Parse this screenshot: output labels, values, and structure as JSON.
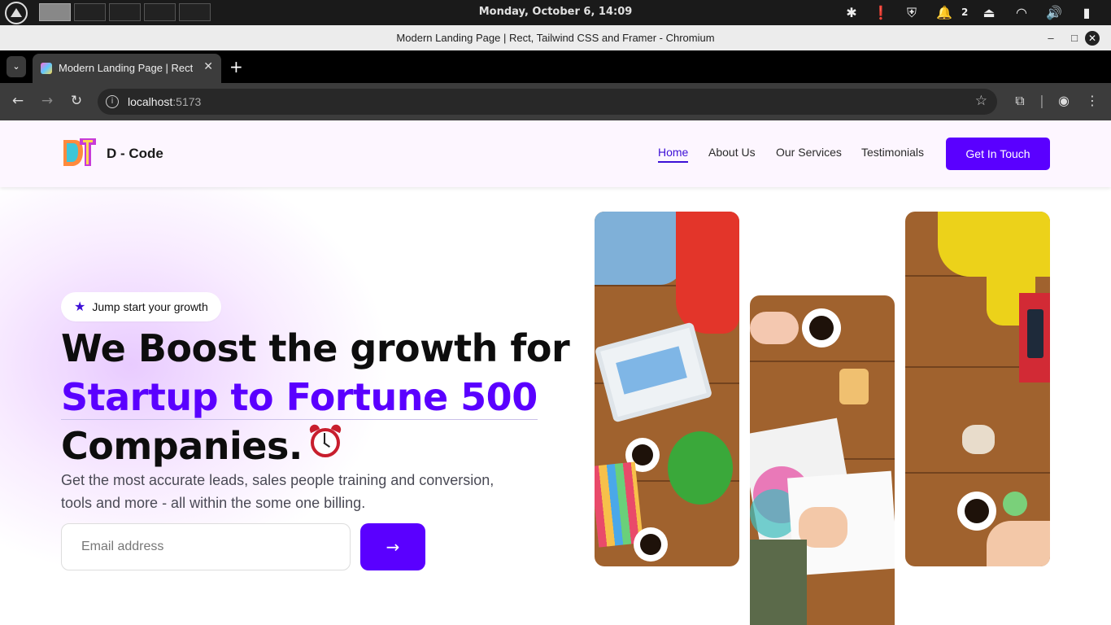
{
  "os": {
    "clock": "Monday, October   6, 14:09",
    "notifications_count": "2"
  },
  "window": {
    "title": "Modern Landing Page | Rect, Tailwind CSS and Framer - Chromium",
    "minimize": "–",
    "maximize": "□",
    "close": "✕"
  },
  "browser": {
    "tab_label": "Modern Landing Page | Rect",
    "tab_close": "✕",
    "new_tab": "+",
    "url_host": "localhost",
    "url_port": ":5173"
  },
  "site": {
    "brand": "D - Code",
    "nav": [
      {
        "label": "Home",
        "active": true
      },
      {
        "label": "About Us"
      },
      {
        "label": "Our Services"
      },
      {
        "label": "Testimonials"
      }
    ],
    "cta": "Get In Touch",
    "hero": {
      "badge": "Jump start your growth",
      "headline_line1": "We Boost the growth for",
      "headline_accent": "Startup to Fortune 500",
      "headline_line3": "Companies.",
      "subtext": "Get the most accurate leads, sales people training and conversion, tools and more - all within the some one billing.",
      "email_placeholder": "Email address",
      "submit_icon": "→"
    }
  },
  "colors": {
    "primary": "#5a00ff",
    "accent_text": "#5a00ff",
    "header_bg": "#fdf6ff"
  }
}
